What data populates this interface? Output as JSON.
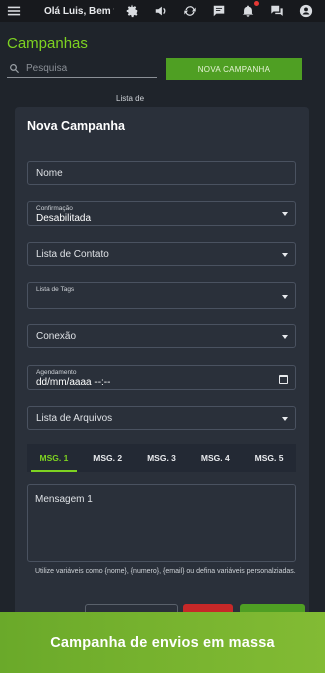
{
  "topbar": {
    "greeting": "Olá Luis, Bem vin...",
    "icons": [
      "menu-icon",
      "settings-icon",
      "volume-icon",
      "sync-icon",
      "chat-icon",
      "bell-icon",
      "forum-icon",
      "account-icon"
    ]
  },
  "page": {
    "title": "Campanhas",
    "search_placeholder": "Pesquisa",
    "new_campaign_button": "NOVA CAMPANHA",
    "table_header_partial": "Lista de"
  },
  "modal": {
    "title": "Nova Campanha",
    "fields": {
      "nome": {
        "label": "Nome"
      },
      "confirmacao": {
        "label": "Confirmação",
        "value": "Desabilitada"
      },
      "lista_contato": {
        "label": "Lista de Contato"
      },
      "lista_tags": {
        "label": "Lista de Tags"
      },
      "conexao": {
        "label": "Conexão"
      },
      "agendamento": {
        "label": "Agendamento",
        "value": "dd/mm/aaaa --:--"
      },
      "lista_arquivos": {
        "label": "Lista de Arquivos"
      }
    },
    "tabs": [
      "MSG. 1",
      "MSG. 2",
      "MSG. 3",
      "MSG. 4",
      "MSG. 5"
    ],
    "active_tab": "MSG. 1",
    "message_label": "Mensagem 1",
    "hint": "Utilize variáveis como {nome}, {numero}, {email} ou defina variáveis personalziadas."
  },
  "banner": {
    "text": "Campanha de envios em massa"
  },
  "colors": {
    "accent": "#7ed321",
    "button_green": "#4f9f23",
    "modal_bg": "#2a303a",
    "page_bg": "#1f242b",
    "danger": "#c62828"
  }
}
